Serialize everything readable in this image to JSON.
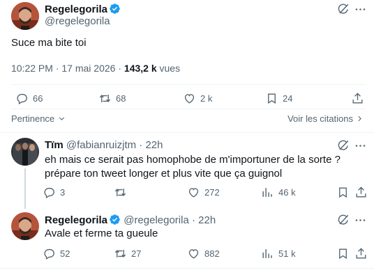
{
  "main_tweet": {
    "name": "Regelegorila",
    "handle": "@regelegorila",
    "text": "Suce ma bite toi",
    "time": "10:22 PM",
    "date": "17 mai 2026",
    "separator": "·",
    "views_count": "143,2 k",
    "views_label": "vues",
    "replies": "66",
    "retweets": "68",
    "likes": "2 k",
    "bookmarks": "24"
  },
  "row_links": {
    "pertinence": "Pertinence",
    "view_quotes": "Voir les citations"
  },
  "reply1": {
    "name": "Tïm",
    "handle": "@fabianruizjtm",
    "separator": "·",
    "time": "22h",
    "text": "eh mais ce serait pas homophobe de m'importuner de la sorte ? prépare ton tweet longer et plus vite que ça guignol",
    "replies": "3",
    "retweets": "",
    "likes": "272",
    "views": "46 k"
  },
  "reply2": {
    "name": "Regelegorila",
    "handle": "@regelegorila",
    "separator": "·",
    "time": "22h",
    "text": "Avale et ferme ta gueule",
    "replies": "52",
    "retweets": "27",
    "likes": "882",
    "views": "51 k"
  },
  "colors": {
    "text": "#0f1419",
    "muted": "#536471",
    "verified": "#1d9bf0",
    "divider": "#eff3f4",
    "thread_line": "#cfd9de"
  },
  "icons": [
    "grok-icon",
    "more-icon",
    "reply-icon",
    "retweet-icon",
    "like-icon",
    "bookmark-icon",
    "share-icon",
    "views-icon",
    "chevron-down-icon",
    "chevron-right-icon",
    "verified-badge-icon"
  ]
}
